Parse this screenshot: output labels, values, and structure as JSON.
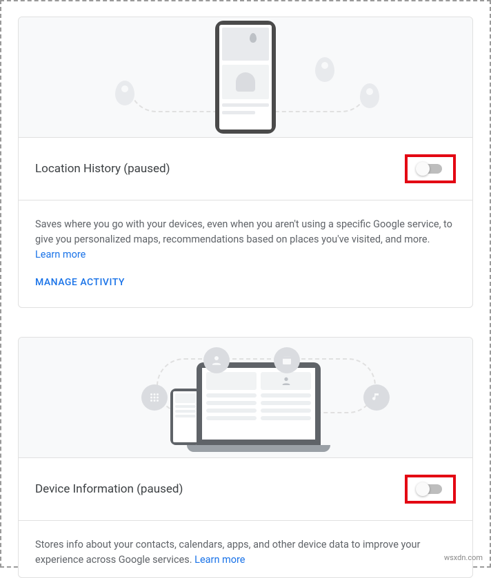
{
  "cards": [
    {
      "title": "Location History (paused)",
      "description": "Saves where you go with your devices, even when you aren't using a specific Google service, to give you personalized maps, recommendations based on places you've visited, and more.",
      "learn_more": "Learn more",
      "manage": "MANAGE ACTIVITY",
      "toggle_on": false
    },
    {
      "title": "Device Information (paused)",
      "description": "Stores info about your contacts, calendars, apps, and other device data to improve your experience across Google services.",
      "learn_more": "Learn more",
      "toggle_on": false
    }
  ],
  "watermark": "wsxdn.com"
}
